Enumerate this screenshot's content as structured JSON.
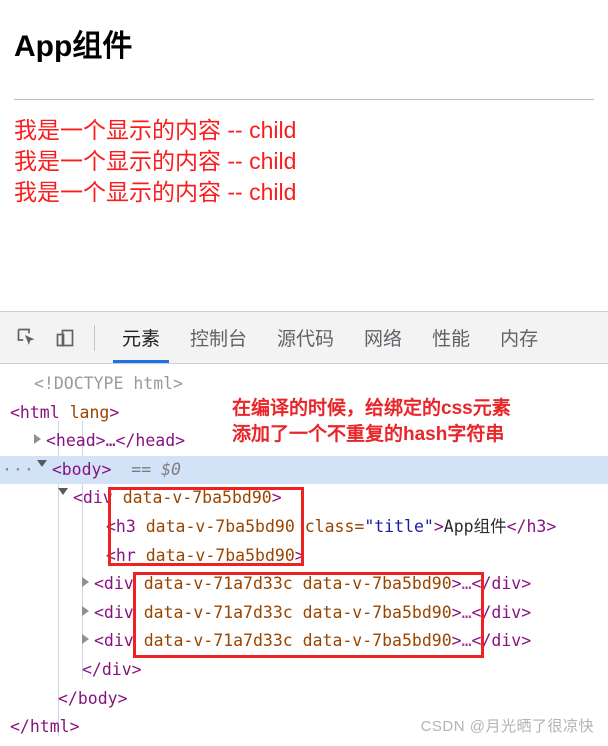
{
  "page": {
    "title": "App组件",
    "child_lines": [
      "我是一个显示的内容 -- child",
      "我是一个显示的内容 -- child",
      "我是一个显示的内容 -- child"
    ],
    "accent_red": "#fb1d1d"
  },
  "devtools": {
    "toolbar": {
      "inspect_icon": "inspect-element-icon",
      "device_icon": "device-toolbar-icon"
    },
    "tabs": [
      {
        "label": "元素",
        "active": true
      },
      {
        "label": "控制台",
        "active": false
      },
      {
        "label": "源代码",
        "active": false
      },
      {
        "label": "网络",
        "active": false
      },
      {
        "label": "性能",
        "active": false
      },
      {
        "label": "内存",
        "active": false
      }
    ],
    "active_tab_underline_color": "#1a73e8",
    "dom": {
      "doctype": "<!DOCTYPE html>",
      "html_open_tag": "<html",
      "html_attr": "lang",
      "html_close_bracket": ">",
      "head_collapsed": "<head>…</head>",
      "body_open": "<body>",
      "body_selected_marker": "== $0",
      "body_dots": "···",
      "div_root_tag": "<div",
      "div_root_attr": "data-v-7ba5bd90",
      "h3_tag": "<h3",
      "h3_attr": "data-v-7ba5bd90",
      "h3_class_name": "class=",
      "h3_class_value": "\"title\"",
      "h3_text": "App组件",
      "h3_close": "</h3>",
      "hr_tag": "<hr",
      "hr_attr": "data-v-7ba5bd90",
      "child_rows": [
        {
          "tag": "<div",
          "attr_child": "data-v-71a7d33c",
          "attr_parent": "data-v-7ba5bd90",
          "ellipsis": "…",
          "close": "</div>"
        },
        {
          "tag": "<div",
          "attr_child": "data-v-71a7d33c",
          "attr_parent": "data-v-7ba5bd90",
          "ellipsis": "…",
          "close": "</div>"
        },
        {
          "tag": "<div",
          "attr_child": "data-v-71a7d33c",
          "attr_parent": "data-v-7ba5bd90",
          "ellipsis": "…",
          "close": "</div>"
        }
      ],
      "div_close": "</div>",
      "body_close": "</body>",
      "html_close": "</html>"
    }
  },
  "annotation": {
    "line1": "在编译的时候，给绑定的css元素",
    "line2": "添加了一个不重复的hash字符串",
    "color": "#e8262a"
  },
  "watermark": {
    "text": "CSDN @月光晒了很凉快"
  }
}
